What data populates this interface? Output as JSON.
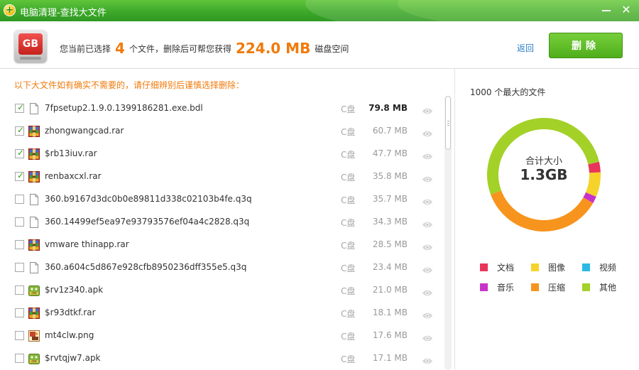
{
  "window": {
    "title": "电脑清理-查找大文件",
    "logo_glyph": "+",
    "close_glyph": "✕"
  },
  "summary": {
    "icon_text": "GB",
    "prefix": "您当前已选择",
    "count": "4",
    "middle": "个文件，删除后可帮您获得",
    "size": "224.0 MB",
    "suffix": "磁盘空间",
    "back_label": "返回",
    "delete_label": "删除"
  },
  "list": {
    "hint": "以下大文件如有确实不需要的，请仔细辨别后谨慎选择删除：",
    "files": [
      {
        "name": "7fpsetup2.1.9.0.1399186281.exe.bdl",
        "drive": "C盘",
        "size": "79.8 MB",
        "checked": true,
        "icon": "generic-file-icon",
        "bold": true
      },
      {
        "name": "zhongwangcad.rar",
        "drive": "C盘",
        "size": "60.7 MB",
        "checked": true,
        "icon": "archive-icon",
        "bold": false
      },
      {
        "name": "$rb13iuv.rar",
        "drive": "C盘",
        "size": "47.7 MB",
        "checked": true,
        "icon": "archive-icon",
        "bold": false
      },
      {
        "name": "renbaxcxl.rar",
        "drive": "C盘",
        "size": "35.8 MB",
        "checked": true,
        "icon": "archive-icon",
        "bold": false
      },
      {
        "name": "360.b9167d3dc0b0e89811d338c02103b4fe.q3q",
        "drive": "C盘",
        "size": "35.7 MB",
        "checked": false,
        "icon": "generic-file-icon",
        "bold": false
      },
      {
        "name": "360.14499ef5ea97e93793576ef04a4c2828.q3q",
        "drive": "C盘",
        "size": "34.3 MB",
        "checked": false,
        "icon": "generic-file-icon",
        "bold": false
      },
      {
        "name": "vmware thinapp.rar",
        "drive": "C盘",
        "size": "28.5 MB",
        "checked": false,
        "icon": "archive-icon",
        "bold": false
      },
      {
        "name": "360.a604c5d867e928cfb8950236dff355e5.q3q",
        "drive": "C盘",
        "size": "23.4 MB",
        "checked": false,
        "icon": "generic-file-icon",
        "bold": false
      },
      {
        "name": "$rv1z340.apk",
        "drive": "C盘",
        "size": "21.0 MB",
        "checked": false,
        "icon": "apk-icon",
        "bold": false
      },
      {
        "name": "$r93dtkf.rar",
        "drive": "C盘",
        "size": "18.1 MB",
        "checked": false,
        "icon": "archive-icon",
        "bold": false
      },
      {
        "name": "mt4clw.png",
        "drive": "C盘",
        "size": "17.6 MB",
        "checked": false,
        "icon": "image-file-icon",
        "bold": false
      },
      {
        "name": "$rvtqjw7.apk",
        "drive": "C盘",
        "size": "17.1 MB",
        "checked": false,
        "icon": "apk-icon",
        "bold": false
      }
    ]
  },
  "chart": {
    "title": "1000 个最大的文件",
    "center_title": "合计大小",
    "center_total": "1.3GB"
  },
  "chart_data": {
    "type": "pie",
    "donut": true,
    "categories": [
      "文档",
      "图像",
      "视频",
      "音乐",
      "压缩",
      "其他"
    ],
    "values": [
      3,
      7,
      0,
      2,
      36,
      52
    ],
    "unit": "%",
    "colors": [
      "#e8355a",
      "#f5d32a",
      "#2cb8e6",
      "#c832c8",
      "#f7941d",
      "#a3d128"
    ],
    "legend": "bottom"
  }
}
